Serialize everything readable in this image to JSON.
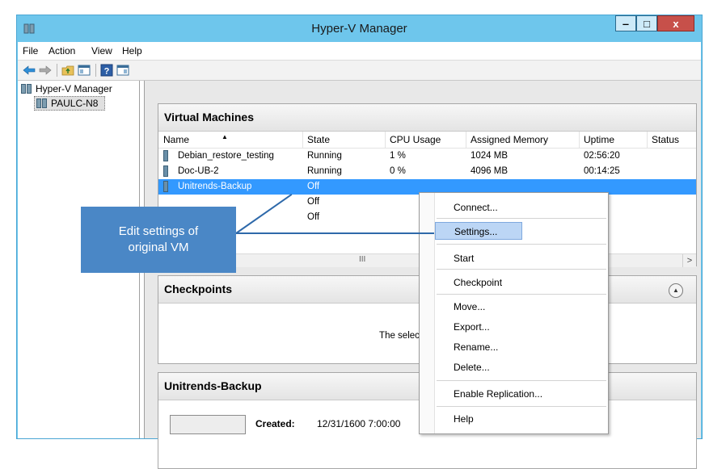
{
  "window": {
    "title": "Hyper-V Manager",
    "controls": {
      "minimize": "‒",
      "maximize": "□",
      "close": "x"
    }
  },
  "menubar": [
    "File",
    "Action",
    "View",
    "Help"
  ],
  "toolbar_icons": [
    "back-arrow-icon",
    "forward-arrow-icon",
    "folder-up-icon",
    "console-tree-icon",
    "help-icon",
    "action-pane-icon"
  ],
  "tree": {
    "root": "Hyper-V Manager",
    "child": "PAULC-N8"
  },
  "vm_pane": {
    "title": "Virtual Machines",
    "columns": [
      "Name",
      "State",
      "CPU Usage",
      "Assigned Memory",
      "Uptime",
      "Status"
    ],
    "rows": [
      {
        "name": "Debian_restore_testing",
        "state": "Running",
        "cpu": "1 %",
        "memory": "1024 MB",
        "uptime": "02:56:20",
        "status": ""
      },
      {
        "name": "Doc-UB-2",
        "state": "Running",
        "cpu": "0 %",
        "memory": "4096 MB",
        "uptime": "00:14:25",
        "status": ""
      },
      {
        "name": "Unitrends-Backup",
        "state": "Off",
        "cpu": "",
        "memory": "",
        "uptime": "",
        "status": "",
        "selected": true
      },
      {
        "name": "",
        "state": "Off",
        "cpu": "",
        "memory": "",
        "uptime": "",
        "status": ""
      },
      {
        "name": "",
        "state": "Off",
        "cpu": "",
        "memory": "",
        "uptime": "",
        "status": ""
      }
    ],
    "scroll_grip": "III",
    "scroll_right": ">"
  },
  "checkpoints_pane": {
    "title": "Checkpoints",
    "message": "The selected virtual ma",
    "collapse_glyph": "▲"
  },
  "details_pane": {
    "title": "Unitrends-Backup",
    "created_label": "Created:",
    "created_value": "12/31/1600 7:00:00"
  },
  "context_menu": {
    "items": [
      "Connect...",
      "Settings...",
      "Start",
      "Checkpoint",
      "Move...",
      "Export...",
      "Rename...",
      "Delete...",
      "Enable Replication...",
      "Help"
    ],
    "highlighted": "Settings..."
  },
  "callout": {
    "line1": "Edit settings of",
    "line2": "original VM",
    "color": "#4a87c6"
  },
  "colors": {
    "window_frame": "#6ec6ec",
    "selection": "#3399ff",
    "menu_highlight": "#bcd6f5",
    "close_button": "#c7504a"
  }
}
